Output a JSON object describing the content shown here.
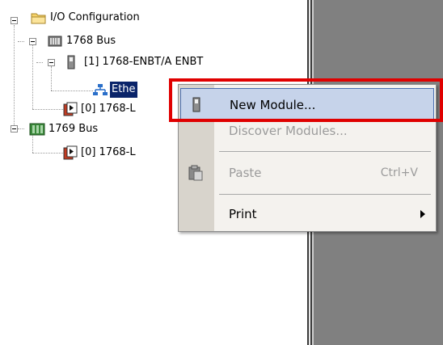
{
  "tree": {
    "root": {
      "label": "I/O Configuration",
      "icon": "folder-icon"
    },
    "bus1": {
      "label": "1768 Bus",
      "icon": "chassis-icon"
    },
    "enbt": {
      "label": "[1] 1768-ENBT/A ENBT",
      "icon": "module-icon"
    },
    "ethernet": {
      "label": "Ethe",
      "icon": "network-icon"
    },
    "l4x_a": {
      "label": "[0] 1768-L",
      "icon": "controller-icon"
    },
    "bus2": {
      "label": "1769 Bus",
      "icon": "chassis-icon"
    },
    "l4x_b": {
      "label": "[0] 1768-L",
      "icon": "controller-icon"
    }
  },
  "context_menu": {
    "items": [
      {
        "label": "New Module...",
        "icon": "new-module-icon",
        "state": "highlighted"
      },
      {
        "label": "Discover Modules...",
        "state": "disabled"
      },
      {
        "label": "Paste",
        "shortcut": "Ctrl+V",
        "icon": "paste-icon",
        "state": "disabled"
      },
      {
        "label": "Print",
        "submenu": "chevron-right-icon"
      }
    ]
  },
  "colors": {
    "selection_bg": "#0a246a",
    "highlight_bg": "#c6d3ea",
    "annotation_red": "#e00000",
    "right_pane": "#808080"
  }
}
